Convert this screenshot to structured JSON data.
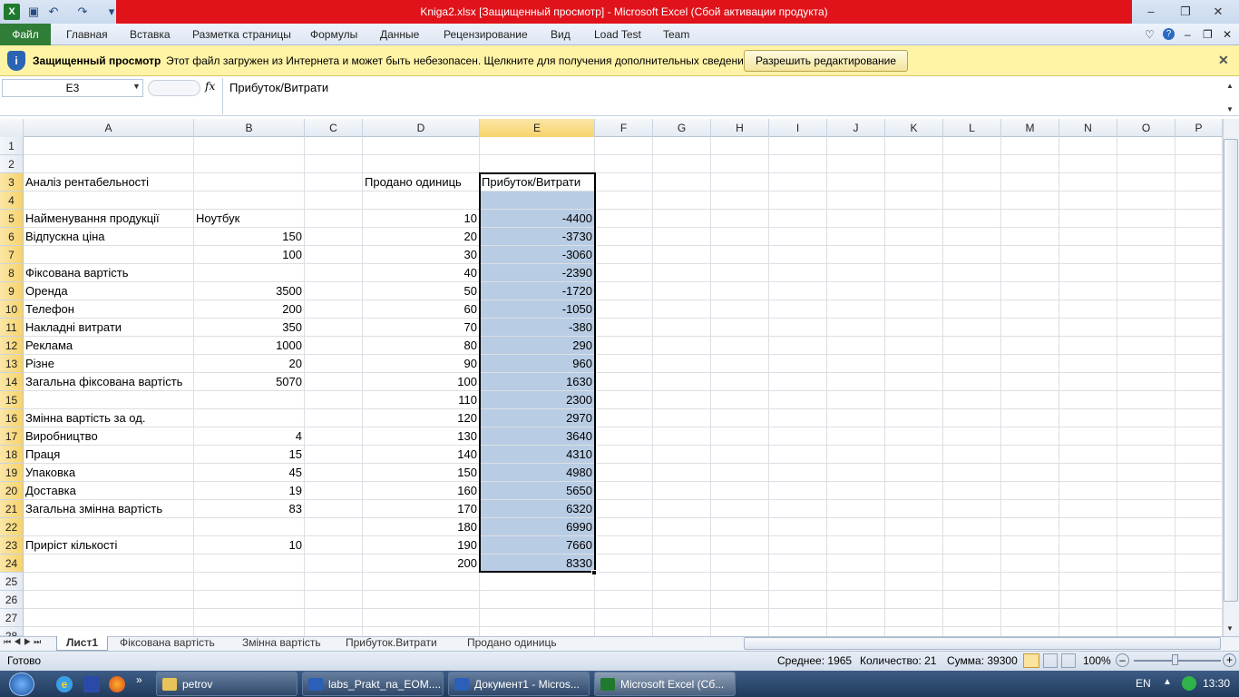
{
  "window": {
    "title": "Kniga2.xlsx  [Защищенный просмотр]  -  Microsoft Excel (Сбой активации продукта)"
  },
  "ribbon": {
    "file_tab": "Файл",
    "tabs": [
      "Главная",
      "Вставка",
      "Разметка страницы",
      "Формулы",
      "Данные",
      "Рецензирование",
      "Вид",
      "Load Test",
      "Team"
    ]
  },
  "protected_view": {
    "title": "Защищенный просмотр",
    "message": "Этот файл загружен из Интернета и может быть небезопасен. Щелкните для получения дополнительных сведений.",
    "button": "Разрешить редактирование"
  },
  "formula_bar": {
    "name_box": "E3",
    "fx": "fx",
    "content": "Прибуток/Витрати"
  },
  "columns": [
    "A",
    "B",
    "C",
    "D",
    "E",
    "F",
    "G",
    "H",
    "I",
    "J",
    "K",
    "L",
    "M",
    "N",
    "O",
    "P"
  ],
  "rows": [
    "1",
    "2",
    "3",
    "4",
    "5",
    "6",
    "7",
    "8",
    "9",
    "10",
    "11",
    "12",
    "13",
    "14",
    "15",
    "16",
    "17",
    "18",
    "19",
    "20",
    "21",
    "22",
    "23",
    "24",
    "25",
    "26",
    "27",
    "28"
  ],
  "cells": {
    "A": {
      "3": "Аналіз рентабельності",
      "5": "Найменування продукції",
      "6": "Відпускна ціна",
      "8": "Фіксована вартість",
      "9": "Оренда",
      "10": "Телефон",
      "11": "Накладні витрати",
      "12": "Реклама",
      "13": "Різне",
      "14": "Загальна фіксована вартість",
      "16": "Змінна вартість за од.",
      "17": "Виробництво",
      "18": "Праця",
      "19": "Упаковка",
      "20": "Доставка",
      "21": "Загальна змінна вартість",
      "23": "Приріст кількості"
    },
    "B_text": {
      "5": "Ноутбук"
    },
    "B": {
      "6": "150",
      "7": "100",
      "9": "3500",
      "10": "200",
      "11": "350",
      "12": "1000",
      "13": "20",
      "14": "5070",
      "17": "4",
      "18": "15",
      "19": "45",
      "20": "19",
      "21": "83",
      "23": "10"
    },
    "D_text": {
      "3": "Продано одиниць"
    },
    "D": {
      "5": "10",
      "6": "20",
      "7": "30",
      "8": "40",
      "9": "50",
      "10": "60",
      "11": "70",
      "12": "80",
      "13": "90",
      "14": "100",
      "15": "110",
      "16": "120",
      "17": "130",
      "18": "140",
      "19": "150",
      "20": "160",
      "21": "170",
      "22": "180",
      "23": "190",
      "24": "200"
    },
    "E_text": {
      "3": "Прибуток/Витрати"
    },
    "E": {
      "5": "-4400",
      "6": "-3730",
      "7": "-3060",
      "8": "-2390",
      "9": "-1720",
      "10": "-1050",
      "11": "-380",
      "12": "290",
      "13": "960",
      "14": "1630",
      "15": "2300",
      "16": "2970",
      "17": "3640",
      "18": "4310",
      "19": "4980",
      "20": "5650",
      "21": "6320",
      "22": "6990",
      "23": "7660",
      "24": "8330"
    }
  },
  "sheets": [
    "Лист1",
    "Фіксована вартість",
    "Змінна вартість",
    "Прибуток.Витрати",
    "Продано одиниць"
  ],
  "active_sheet": "Лист1",
  "status": {
    "ready": "Готово",
    "average": "Среднее: 1965",
    "count": "Количество: 21",
    "sum": "Сумма: 39300",
    "zoom": "100%"
  },
  "taskbar": {
    "items": [
      "petrov",
      "labs_Prakt_na_EOM....",
      "Документ1 - Micros...",
      "Microsoft Excel (Сб..."
    ],
    "lang": "EN",
    "time": "13:30"
  },
  "colors": {
    "title_red": "#e0131b",
    "selection": "#b8cce4",
    "file_tab": "#2f7d36",
    "protected_bar": "#fff3a5"
  }
}
